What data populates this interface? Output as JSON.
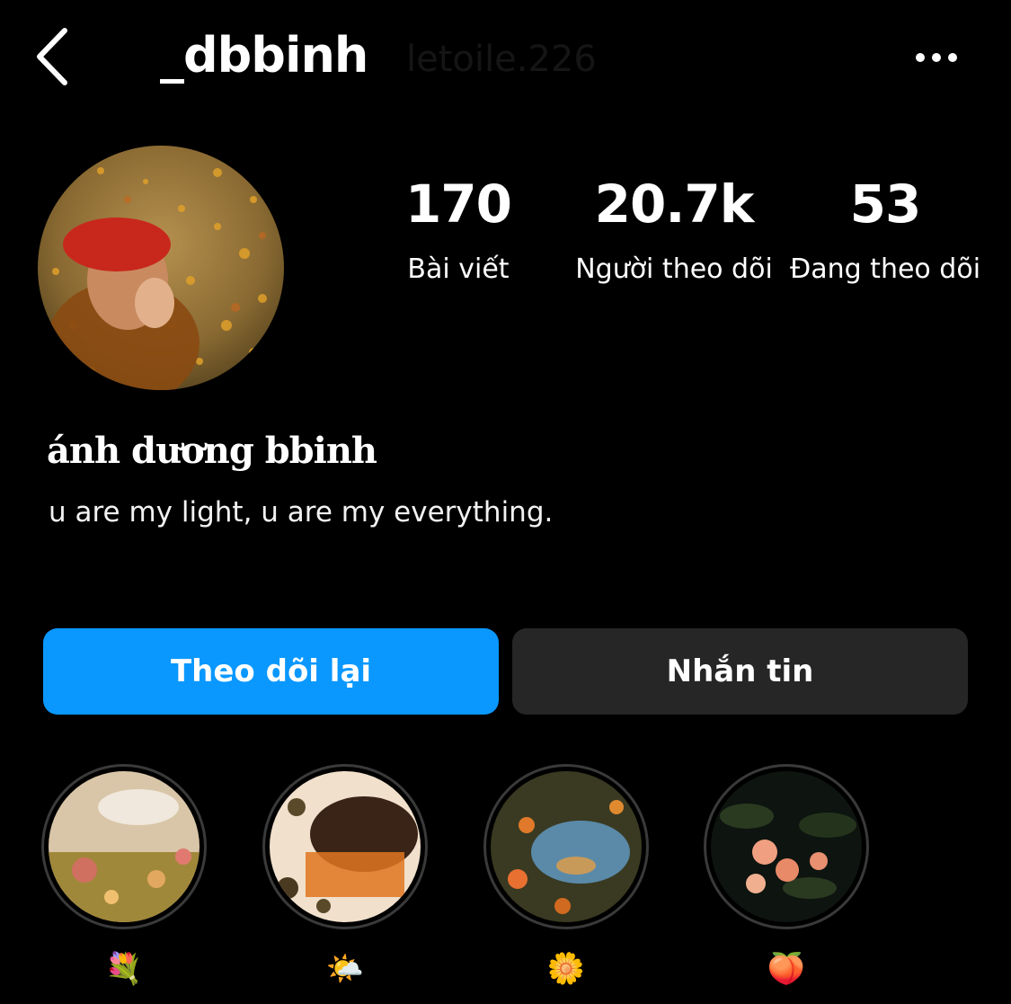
{
  "header": {
    "username": "_dbbinh",
    "faint_text": "letoile.226"
  },
  "profile": {
    "display_name": "ánh dương bbinh",
    "bio": "u are my light, u are my everything."
  },
  "stats": {
    "posts_value": "170",
    "posts_label": "Bài viết",
    "followers_value": "20.7k",
    "followers_label": "Người theo dõi",
    "following_value": "53",
    "following_label": "Đang theo dõi"
  },
  "actions": {
    "follow_back": "Theo dõi lại",
    "message": "Nhắn tin"
  },
  "highlights": [
    {
      "emoji": "💐"
    },
    {
      "emoji": "🌤️"
    },
    {
      "emoji": "🌼"
    },
    {
      "emoji": "🍑"
    }
  ],
  "colors": {
    "background": "#000000",
    "primary_button": "#0a98ff",
    "secondary_button": "#262626"
  },
  "icons": [
    "back-arrow-icon",
    "more-options-icon"
  ]
}
